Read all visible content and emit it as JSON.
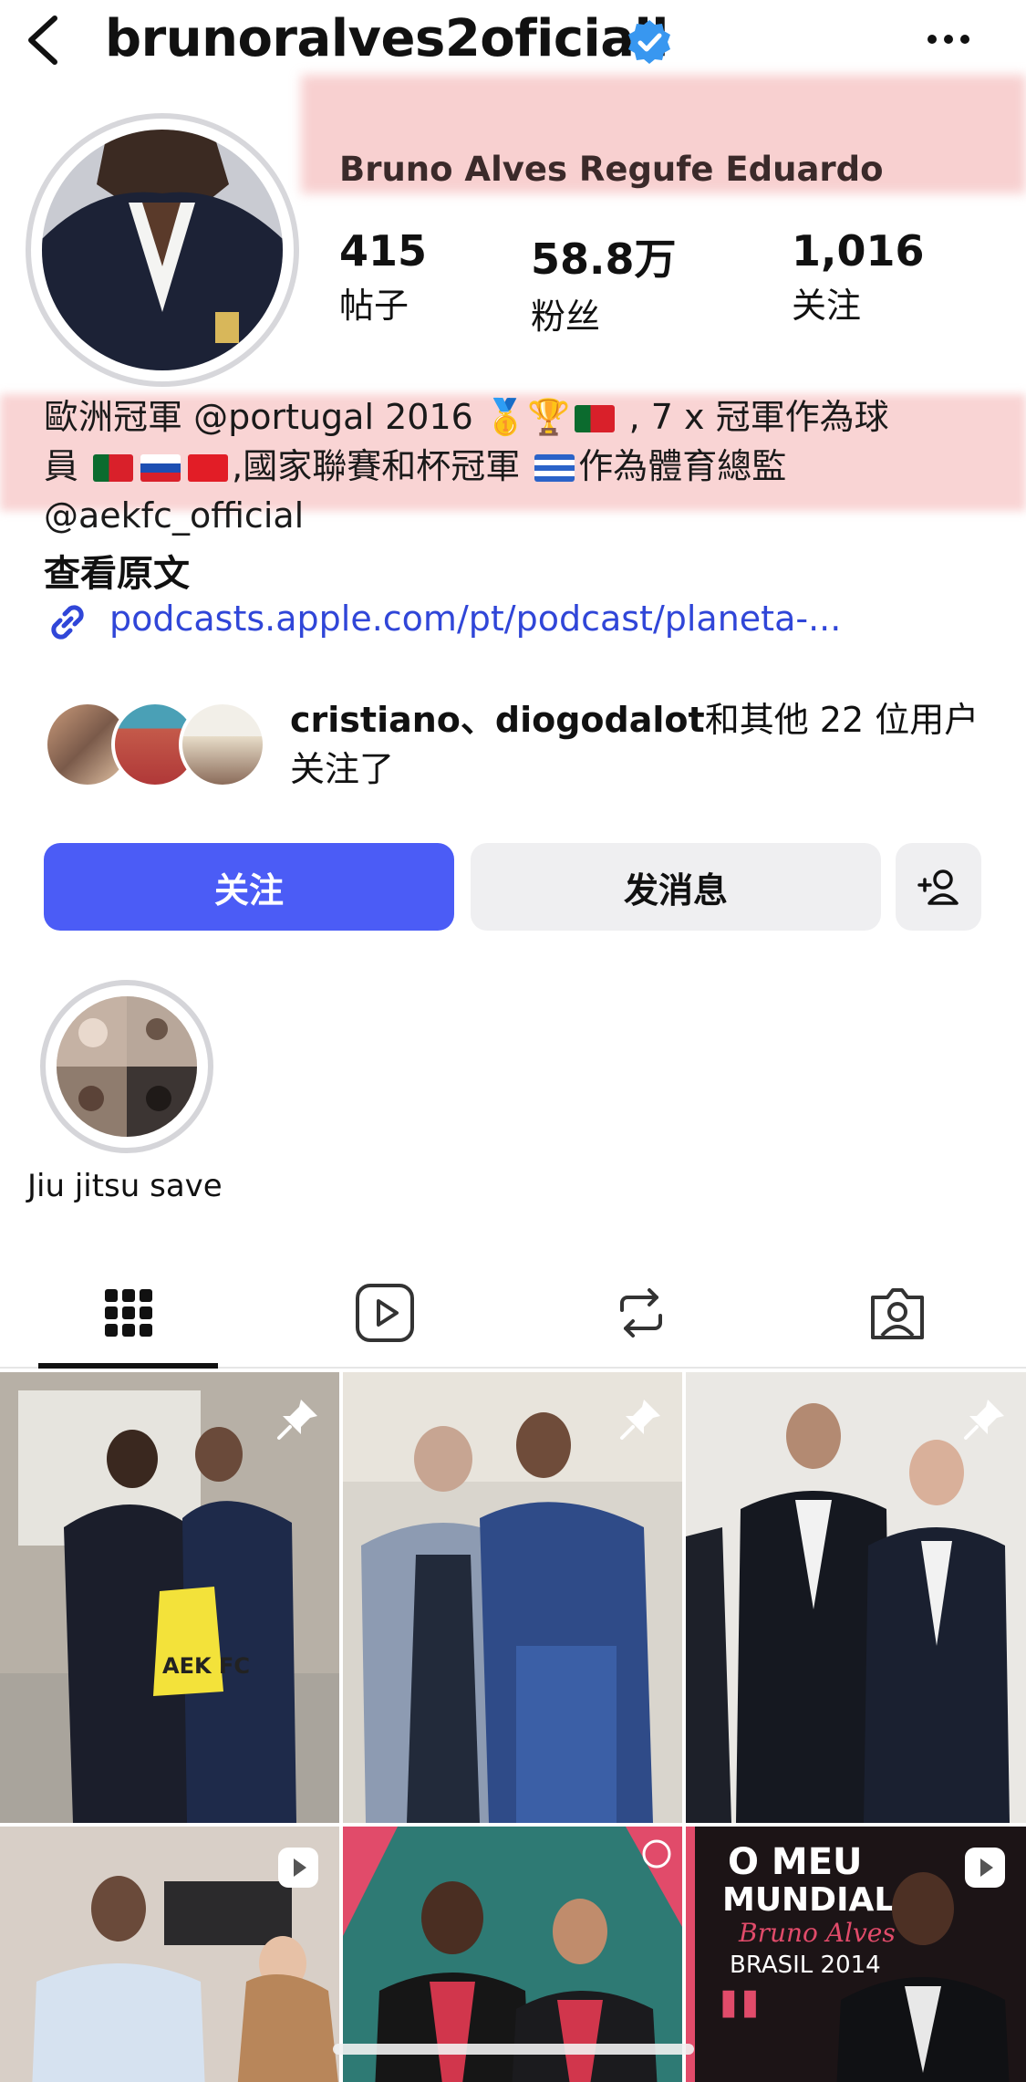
{
  "header": {
    "username": "brunoralves2oficiall",
    "back_icon": "chevron-left-icon",
    "verified_icon": "verified-badge-icon",
    "more_icon": "more-horizontal-icon"
  },
  "profile": {
    "full_name": "Bruno Alves Regufe Eduardo",
    "stats": [
      {
        "value": "415",
        "label": "帖子"
      },
      {
        "value": "58.8万",
        "label": "粉丝"
      },
      {
        "value": "1,016",
        "label": "关注"
      }
    ],
    "bio_line1_a": "歐洲冠軍 @portugal 2016",
    "bio_line1_b": ", 7 x 冠軍作為球",
    "bio_line2_a": "員",
    "bio_line2_b": ",國家聯賽和杯冠軍",
    "bio_line2_c": "作為體育總監",
    "bio_line3": "@aekfc_official",
    "see_original": "查看原文",
    "link": "podcasts.apple.com/pt/podcast/planeta-...",
    "followed_by_names": "cristiano、diogodalot",
    "followed_by_rest": "和其他 22 位用户关注了"
  },
  "actions": {
    "follow": "关注",
    "message": "发消息",
    "add_user_icon": "add-person-icon"
  },
  "highlights": [
    {
      "label": "Jiu jitsu save"
    }
  ],
  "tabs": [
    {
      "name": "posts-grid",
      "icon": "grid-icon",
      "active": true
    },
    {
      "name": "reels",
      "icon": "reels-icon",
      "active": false
    },
    {
      "name": "reposts",
      "icon": "repost-icon",
      "active": false
    },
    {
      "name": "tagged",
      "icon": "tagged-person-icon",
      "active": false
    }
  ],
  "grid_texts": {
    "tile5_title": "O MEU",
    "tile5_title2": "MUNDIAL",
    "tile5_script": "Bruno Alves",
    "tile5_sub": "BRASIL 2014",
    "bag_text": "AEK FC"
  },
  "colors": {
    "primary_button": "#4b5cf6",
    "link": "#3046d8",
    "verified": "#3897f0"
  }
}
